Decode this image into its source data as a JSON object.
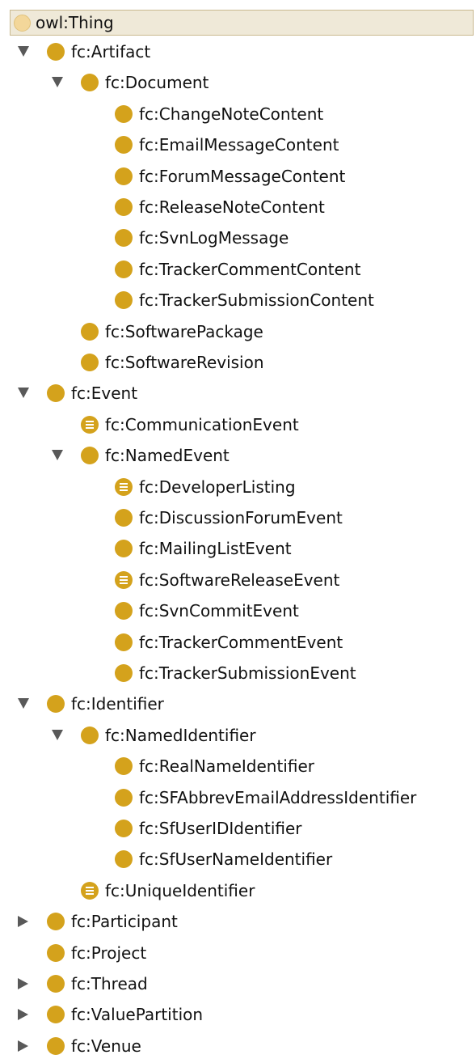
{
  "root": {
    "label": "owl:Thing",
    "icon": "class-circle-icon"
  },
  "nodes": [
    {
      "label": "fc:Artifact",
      "depth": 0,
      "toggle": "open",
      "icon": "class"
    },
    {
      "label": "fc:Document",
      "depth": 1,
      "toggle": "open",
      "icon": "class"
    },
    {
      "label": "fc:ChangeNoteContent",
      "depth": 2,
      "toggle": "none",
      "icon": "class"
    },
    {
      "label": "fc:EmailMessageContent",
      "depth": 2,
      "toggle": "none",
      "icon": "class"
    },
    {
      "label": "fc:ForumMessageContent",
      "depth": 2,
      "toggle": "none",
      "icon": "class"
    },
    {
      "label": "fc:ReleaseNoteContent",
      "depth": 2,
      "toggle": "none",
      "icon": "class"
    },
    {
      "label": "fc:SvnLogMessage",
      "depth": 2,
      "toggle": "none",
      "icon": "class"
    },
    {
      "label": "fc:TrackerCommentContent",
      "depth": 2,
      "toggle": "none",
      "icon": "class"
    },
    {
      "label": "fc:TrackerSubmissionContent",
      "depth": 2,
      "toggle": "none",
      "icon": "class"
    },
    {
      "label": "fc:SoftwarePackage",
      "depth": 1,
      "toggle": "none",
      "icon": "class"
    },
    {
      "label": "fc:SoftwareRevision",
      "depth": 1,
      "toggle": "none",
      "icon": "class"
    },
    {
      "label": "fc:Event",
      "depth": 0,
      "toggle": "open",
      "icon": "class"
    },
    {
      "label": "fc:CommunicationEvent",
      "depth": 1,
      "toggle": "none",
      "icon": "defined"
    },
    {
      "label": "fc:NamedEvent",
      "depth": 1,
      "toggle": "open",
      "icon": "class"
    },
    {
      "label": "fc:DeveloperListing",
      "depth": 2,
      "toggle": "none",
      "icon": "defined"
    },
    {
      "label": "fc:DiscussionForumEvent",
      "depth": 2,
      "toggle": "none",
      "icon": "class"
    },
    {
      "label": "fc:MailingListEvent",
      "depth": 2,
      "toggle": "none",
      "icon": "class"
    },
    {
      "label": "fc:SoftwareReleaseEvent",
      "depth": 2,
      "toggle": "none",
      "icon": "defined"
    },
    {
      "label": "fc:SvnCommitEvent",
      "depth": 2,
      "toggle": "none",
      "icon": "class"
    },
    {
      "label": "fc:TrackerCommentEvent",
      "depth": 2,
      "toggle": "none",
      "icon": "class"
    },
    {
      "label": "fc:TrackerSubmissionEvent",
      "depth": 2,
      "toggle": "none",
      "icon": "class"
    },
    {
      "label": "fc:Identifier",
      "depth": 0,
      "toggle": "open",
      "icon": "class"
    },
    {
      "label": "fc:NamedIdentifier",
      "depth": 1,
      "toggle": "open",
      "icon": "class"
    },
    {
      "label": "fc:RealNameIdentifier",
      "depth": 2,
      "toggle": "none",
      "icon": "class"
    },
    {
      "label": "fc:SFAbbrevEmailAddressIdentifier",
      "depth": 2,
      "toggle": "none",
      "icon": "class"
    },
    {
      "label": "fc:SfUserIDIdentifier",
      "depth": 2,
      "toggle": "none",
      "icon": "class"
    },
    {
      "label": "fc:SfUserNameIdentifier",
      "depth": 2,
      "toggle": "none",
      "icon": "class"
    },
    {
      "label": "fc:UniqueIdentifier",
      "depth": 1,
      "toggle": "none",
      "icon": "defined"
    },
    {
      "label": "fc:Participant",
      "depth": 0,
      "toggle": "closed",
      "icon": "class"
    },
    {
      "label": "fc:Project",
      "depth": 0,
      "toggle": "none",
      "icon": "class"
    },
    {
      "label": "fc:Thread",
      "depth": 0,
      "toggle": "closed",
      "icon": "class"
    },
    {
      "label": "fc:ValuePartition",
      "depth": 0,
      "toggle": "closed",
      "icon": "class"
    },
    {
      "label": "fc:Venue",
      "depth": 0,
      "toggle": "closed",
      "icon": "class"
    }
  ],
  "colors": {
    "class_circle": "#d4a21c",
    "root_circle": "#f3d79a",
    "root_background": "#efe9d8",
    "toggle": "#595959"
  }
}
